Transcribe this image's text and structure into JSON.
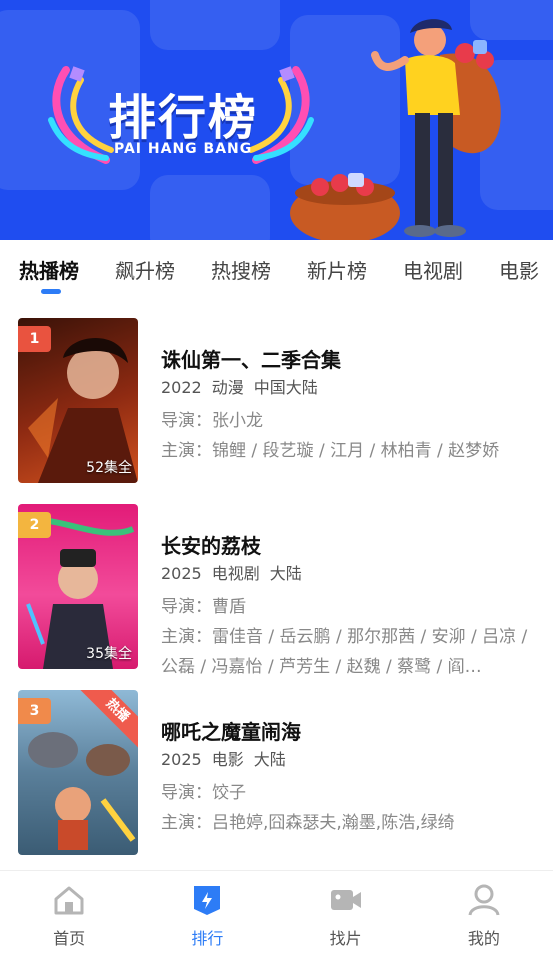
{
  "banner": {
    "title": "排行榜",
    "subtitle": "PAI HANG BANG"
  },
  "tabs": [
    {
      "label": "热播榜",
      "active": true
    },
    {
      "label": "飙升榜",
      "active": false
    },
    {
      "label": "热搜榜",
      "active": false
    },
    {
      "label": "新片榜",
      "active": false
    },
    {
      "label": "电视剧",
      "active": false
    },
    {
      "label": "电影",
      "active": false
    }
  ],
  "items": [
    {
      "rank": "1",
      "rank_color": "#e9533f",
      "title": "诛仙第一、二季合集",
      "year": "2022",
      "genre": "动漫",
      "region": "中国大陆",
      "director": "导演：张小龙",
      "cast": "主演：锦鲤 / 段艺璇 / 江月 / 林柏青 / 赵梦娇",
      "episodes": "52集全",
      "hot": "",
      "poster_colors": [
        "#3a1208",
        "#8e2a12",
        "#d2521e"
      ]
    },
    {
      "rank": "2",
      "rank_color": "#f3b53f",
      "title": "长安的荔枝",
      "year": "2025",
      "genre": "电视剧",
      "region": "大陆",
      "director": "导演：曹盾",
      "cast": "主演：雷佳音 / 岳云鹏 / 那尔那茜 / 安泖 / 吕凉 / 公磊 / 冯嘉怡 / 芦芳生 / 赵魏 / 蔡鹭 / 阎…",
      "episodes": "35集全",
      "hot": "",
      "poster_colors": [
        "#e21b78",
        "#f24b9a",
        "#2a2a3a"
      ]
    },
    {
      "rank": "3",
      "rank_color": "#f08a4b",
      "title": "哪吒之魔童闹海",
      "year": "2025",
      "genre": "电影",
      "region": "大陆",
      "director": "导演：饺子",
      "cast": "主演：吕艳婷,囧森瑟夫,瀚墨,陈浩,绿绮",
      "episodes": "",
      "hot": "热播",
      "poster_colors": [
        "#8fb9d6",
        "#5a7f9a",
        "#c94a2a"
      ]
    }
  ],
  "nav": [
    {
      "label": "首页",
      "icon": "home-icon",
      "active": false
    },
    {
      "label": "排行",
      "icon": "ranking-icon",
      "active": true
    },
    {
      "label": "找片",
      "icon": "video-camera-icon",
      "active": false
    },
    {
      "label": "我的",
      "icon": "user-icon",
      "active": false
    }
  ],
  "colors": {
    "accent": "#2d7cf6",
    "banner_bg": "#1f4df0"
  }
}
